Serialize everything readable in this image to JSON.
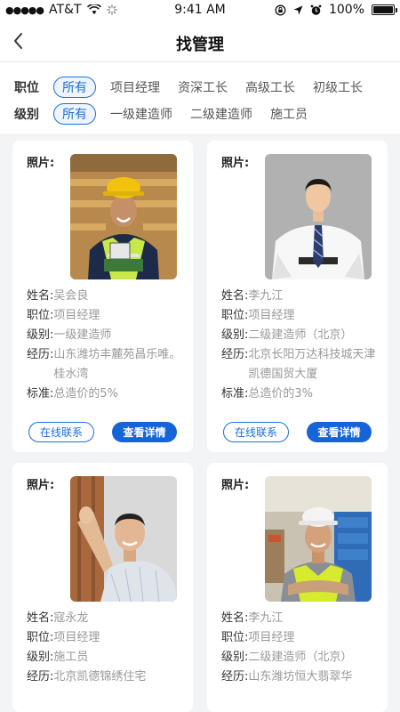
{
  "status_bar": {
    "carrier": "AT&T",
    "time": "9:41 AM",
    "battery": "100%",
    "battery_level": 1.0
  },
  "nav": {
    "title": "找管理"
  },
  "filters": {
    "position": {
      "label": "职位",
      "options": [
        "所有",
        "项目经理",
        "资深工长",
        "高级工长",
        "初级工长"
      ],
      "selected": "所有"
    },
    "level": {
      "label": "级别",
      "options": [
        "所有",
        "一级建造师",
        "二级建造师",
        "施工员"
      ],
      "selected": "所有"
    }
  },
  "card_labels": {
    "photo": "照片:",
    "name": "姓名:",
    "position": "职位:",
    "level": "级别:",
    "experience": "经历:",
    "standard": "标准:",
    "contact_button": "在线联系",
    "detail_button": "查看详情"
  },
  "cards": [
    {
      "name": "吴会良",
      "position": "项目经理",
      "level": "一级建造师",
      "experience": "山东潍坊丰麓苑昌乐唯。桂水湾",
      "standard": "总造价的5%"
    },
    {
      "name": "李九江",
      "position": "项目经理",
      "level": "二级建造师（北京）",
      "experience": "北京长阳万达科技城天津凯德国贸大厦",
      "standard": "总造价的3%"
    },
    {
      "name": "寇永龙",
      "position": "项目经理",
      "level": "施工员",
      "experience": "北京凯德锦绣住宅"
    },
    {
      "name": "李九江",
      "position": "项目经理",
      "level": "二级建造师（北京）",
      "experience": "山东潍坊恒大翡翠华"
    }
  ]
}
